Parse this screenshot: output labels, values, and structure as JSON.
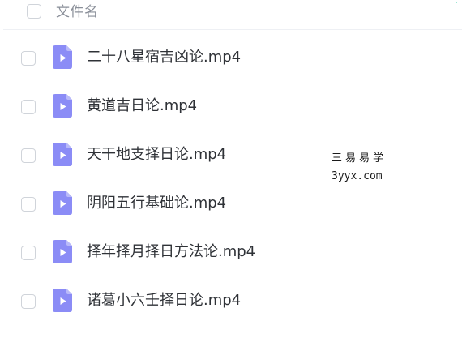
{
  "header": {
    "column_label": "文件名"
  },
  "files": [
    {
      "name": "二十八星宿吉凶论.mp4",
      "icon": "video-file-icon"
    },
    {
      "name": "黄道吉日论.mp4",
      "icon": "video-file-icon"
    },
    {
      "name": "天干地支择日论.mp4",
      "icon": "video-file-icon"
    },
    {
      "name": "阴阳五行基础论.mp4",
      "icon": "video-file-icon"
    },
    {
      "name": "择年择月择日方法论.mp4",
      "icon": "video-file-icon"
    },
    {
      "name": "诸葛小六壬择日论.mp4",
      "icon": "video-file-icon"
    }
  ],
  "watermark": {
    "title": "三易易学",
    "url": "3yyx.com"
  },
  "colors": {
    "icon_purple": "#8b8cf6",
    "icon_fold": "#b9baf9",
    "text": "#2f3237",
    "muted": "#8a8f99"
  }
}
